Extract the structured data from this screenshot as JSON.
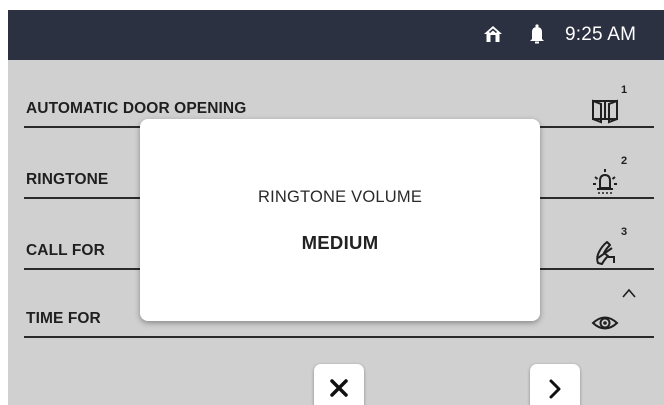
{
  "status_bar": {
    "icons": [
      "home-icon",
      "bell-icon"
    ],
    "time": "9:25 AM"
  },
  "menu": {
    "items": [
      {
        "label": "AUTOMATIC DOOR OPENING",
        "icon": "door-icon",
        "index": "1"
      },
      {
        "label": "RINGTONE",
        "icon": "bell-light-icon",
        "index": "2"
      },
      {
        "label": "CALL FOR",
        "icon": "call-forward-icon",
        "index": "3"
      },
      {
        "label": "TIME FOR",
        "icon": "eye-icon",
        "index": ""
      }
    ]
  },
  "modal": {
    "title": "RINGTONE VOLUME",
    "value": "MEDIUM"
  },
  "nav": {
    "close_icon": "close-icon",
    "next_icon": "chevron-right-icon"
  },
  "colors": {
    "status_bar_bg": "#2c3141",
    "screen_bg": "#d0d0d0",
    "modal_bg": "#ffffff"
  }
}
